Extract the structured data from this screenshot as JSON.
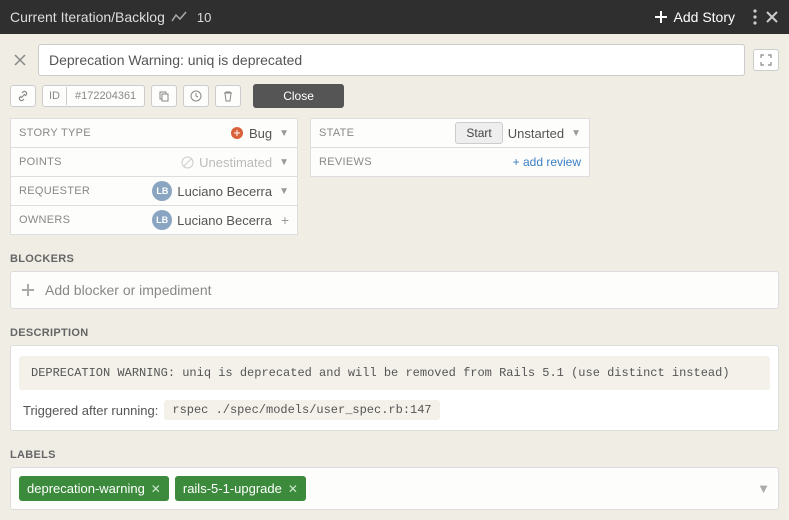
{
  "header": {
    "title": "Current Iteration/Backlog",
    "count": "10",
    "add_story": "Add Story"
  },
  "story": {
    "title": "Deprecation Warning: uniq is deprecated",
    "id_label": "ID",
    "id_value": "#172204361",
    "close_btn": "Close"
  },
  "fields": {
    "story_type": {
      "label": "STORY TYPE",
      "value": "Bug"
    },
    "points": {
      "label": "POINTS",
      "value": "Unestimated"
    },
    "requester": {
      "label": "REQUESTER",
      "value": "Luciano Becerra",
      "initials": "LB"
    },
    "owners": {
      "label": "OWNERS",
      "value": "Luciano Becerra",
      "initials": "LB"
    },
    "state": {
      "label": "STATE",
      "start": "Start",
      "value": "Unstarted"
    },
    "reviews": {
      "label": "REVIEWS",
      "add": "+ add review"
    }
  },
  "blockers": {
    "heading": "BLOCKERS",
    "placeholder": "Add blocker or impediment"
  },
  "description": {
    "heading": "DESCRIPTION",
    "warning": "DEPRECATION WARNING: uniq is deprecated and will be removed from Rails 5.1 (use distinct instead)",
    "triggered": "Triggered after running:",
    "command": "rspec ./spec/models/user_spec.rb:147"
  },
  "labels": {
    "heading": "LABELS",
    "tags": [
      "deprecation-warning",
      "rails-5-1-upgrade"
    ]
  }
}
